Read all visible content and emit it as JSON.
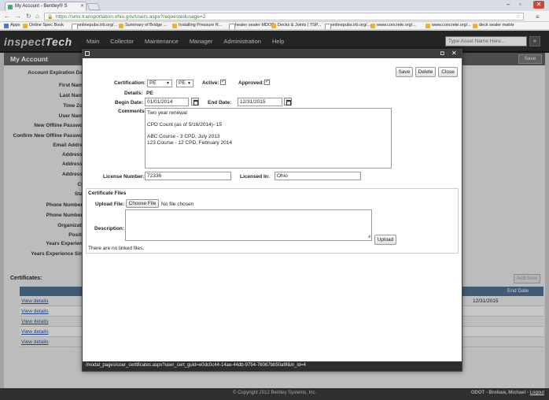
{
  "browser": {
    "tab_title": "My Account - Bentley® S",
    "url": "https://sms.transportation.ohio.gov/users.aspx?requestedusage=2",
    "bookmarks": [
      {
        "label": "Apps",
        "kind": "apps"
      },
      {
        "label": "Online Spec Book",
        "kind": "folder"
      },
      {
        "label": "onlinepubs.trb.org/...",
        "kind": "doc"
      },
      {
        "label": "Summary of Bridge ...",
        "kind": "folder"
      },
      {
        "label": "Installing Pressure R...",
        "kind": "folder"
      },
      {
        "label": "healer sealer MDOT",
        "kind": "doc"
      },
      {
        "label": "Decks & Joints | TSP...",
        "kind": "folder"
      },
      {
        "label": "onlinepubs.trb.org/...",
        "kind": "doc"
      },
      {
        "label": "www.concrete.org/...",
        "kind": "folder"
      },
      {
        "label": "www.concrete.org/...",
        "kind": "folder"
      },
      {
        "label": "deck sealer matrix",
        "kind": "folder"
      }
    ]
  },
  "app": {
    "logo_a": "inspect",
    "logo_b": "Tech",
    "nav": [
      "Main",
      "Collector",
      "Maintenance",
      "Manager",
      "Administration",
      "Help"
    ],
    "search_placeholder": "Type Asset Name Here...",
    "search_go": "»"
  },
  "page": {
    "title": "My Account",
    "save_label": "Save",
    "field_labels": [
      "Account Expiration Da",
      "First Nam",
      "Last Nam",
      "Time Zo",
      "User Nam",
      "New Offline Passwo",
      "Confirm New Offline Passwo",
      "Email Addre",
      "Address",
      "Address",
      "Address",
      "Ci",
      "Sta",
      "Phone Number",
      "Phone Number",
      "Organizati",
      "Positi",
      "Years Experien",
      "Years Experience Sin"
    ],
    "certificates_label": "Certificates:",
    "add_new_label": "Add New",
    "cert_table_end_date_header": "End Date",
    "cert_rows": [
      {
        "link": "View details",
        "end_date": "12/31/2015"
      },
      {
        "link": "View details",
        "end_date": ""
      },
      {
        "link": "View details",
        "end_date": ""
      },
      {
        "link": "View details",
        "end_date": ""
      },
      {
        "link": "View details",
        "end_date": ""
      }
    ]
  },
  "modal": {
    "buttons": {
      "save": "Save",
      "delete": "Delete",
      "close": "Close"
    },
    "certification_label": "Certification:",
    "certification_value": "PE",
    "certification_sub_value": "PE",
    "active_label": "Active:",
    "approved_label": "Approved:",
    "details_label": "Details:",
    "details_value": "PE",
    "begin_date_label": "Begin Date:",
    "begin_date_value": "01/01/2014",
    "end_date_label": "End Date:",
    "end_date_value": "12/31/2015",
    "comments_label": "Comments:",
    "comments_value": "Two year renewal\n\nCPD Count (as of 5/16/2014)- 15\n\nABC Course - 3 CPD, July 2013\n123 Course - 12 CPD, February 2014",
    "license_number_label": "License Number:",
    "license_number_value": "72336",
    "licensed_in_label": "Licensed In:",
    "licensed_in_value": "Ohio",
    "files_title": "Certificate Files",
    "upload_file_label": "Upload File:",
    "choose_file_label": "Choose File",
    "no_file_text": "No file chosen",
    "description_label": "Description:",
    "upload_label": "Upload",
    "no_linked_files": "There are no linked files.",
    "status_url": "/modal_pages/user_certificates.aspx?user_cert_guid=e0dc0c44-14ae-44db-9754-76067bb50a9f&in_id=4"
  },
  "footer": {
    "copyright": "© Copyright 2012 Bentley Systems, Inc.",
    "user": "ODOT - Brokaw, Michael -",
    "logout": "Logout"
  }
}
